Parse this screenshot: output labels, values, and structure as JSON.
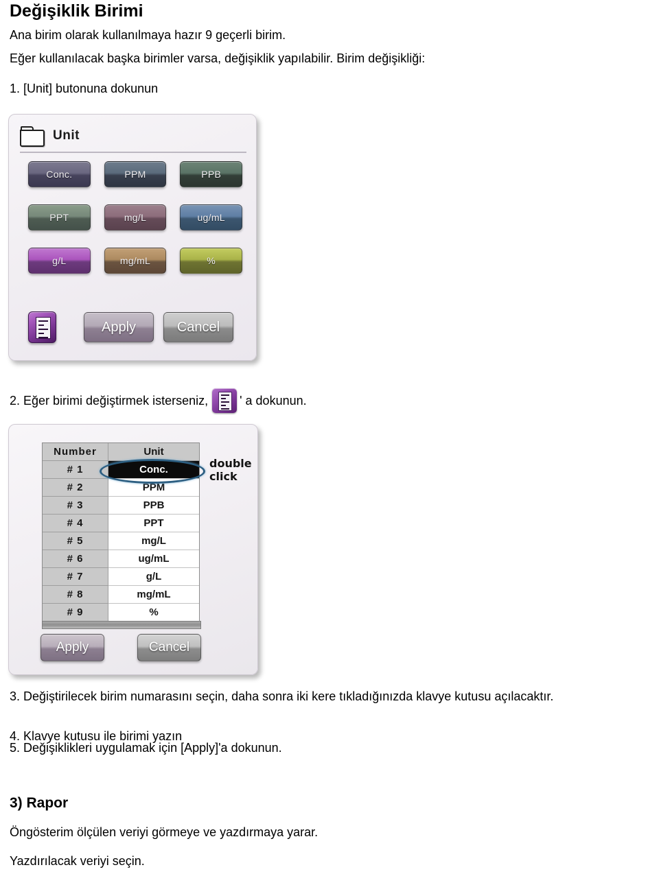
{
  "document": {
    "title": "Değişiklik Birimi",
    "intro_line1": "Ana birim olarak kullanılmaya hazır 9 geçerli birim.",
    "intro_line2": "Eğer kullanılacak başka birimler varsa, değişiklik yapılabilir. Birim değişikliği:",
    "step1": "1. [Unit] butonuna dokunun",
    "step2_before": "2. Eğer birimi değiştirmek isterseniz,",
    "step2_after": "' a dokunun.",
    "step3": "3. Değiştirilecek birim numarasını seçin, daha sonra iki kere tıkladığınızda klavye kutusu açılacaktır.",
    "step4": "4. Klavye kutusu ile birimi yazın",
    "step5": "5. Değişiklikleri uygulamak için [Apply]'a dokunun.",
    "section_title": "3) Rapor",
    "section_line1": "Öngösterim ölçülen veriyi görmeye ve yazdırmaya yarar.",
    "section_line2": "Yazdırılacak veriyi seçin."
  },
  "unit_dialog": {
    "title": "Unit",
    "folder_icon": "folder-icon",
    "unit_buttons": [
      {
        "label": "Conc.",
        "color": "#6a6780"
      },
      {
        "label": "PPM",
        "color": "#5b6b7c"
      },
      {
        "label": "PPB",
        "color": "#5a7366"
      },
      {
        "label": "PPT",
        "color": "#77897a"
      },
      {
        "label": "mg/L",
        "color": "#8d6d7c"
      },
      {
        "label": "ug/mL",
        "color": "#5f7ea4"
      },
      {
        "label": "g/L",
        "color": "#ab55bd"
      },
      {
        "label": "mg/mL",
        "color": "#ad8a60"
      },
      {
        "label": "%",
        "color": "#aab349"
      }
    ],
    "report_icon": "report-list-icon",
    "apply_label": "Apply",
    "cancel_label": "Cancel"
  },
  "unit_list_dialog": {
    "columns": [
      "Number",
      "Unit"
    ],
    "rows": [
      {
        "number": "# 1",
        "unit": "Conc.",
        "selected": true
      },
      {
        "number": "# 2",
        "unit": "PPM",
        "selected": false
      },
      {
        "number": "# 3",
        "unit": "PPB",
        "selected": false
      },
      {
        "number": "# 4",
        "unit": "PPT",
        "selected": false
      },
      {
        "number": "# 5",
        "unit": "mg/L",
        "selected": false
      },
      {
        "number": "# 6",
        "unit": "ug/mL",
        "selected": false
      },
      {
        "number": "# 7",
        "unit": "g/L",
        "selected": false
      },
      {
        "number": "# 8",
        "unit": "mg/mL",
        "selected": false
      },
      {
        "number": "# 9",
        "unit": "%",
        "selected": false
      }
    ],
    "annotation": "double\nclick",
    "annotation_line1": "double",
    "annotation_line2": "click",
    "highlight_color": "#2d5f82",
    "apply_label": "Apply",
    "cancel_label": "Cancel"
  }
}
